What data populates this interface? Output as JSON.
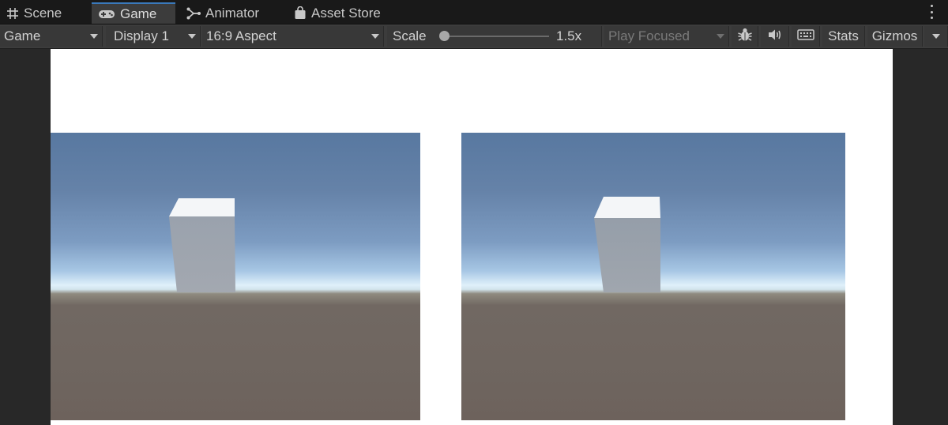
{
  "tabs": [
    {
      "label": "Scene",
      "icon": "grid-icon"
    },
    {
      "label": "Game",
      "icon": "gamepad-icon"
    },
    {
      "label": "Animator",
      "icon": "animator-icon"
    },
    {
      "label": "Asset Store",
      "icon": "shopping-bag-icon"
    }
  ],
  "toolbar": {
    "view_select": "Game",
    "display_select": "Display 1",
    "aspect_select": "16:9 Aspect",
    "scale_label": "Scale",
    "scale_value": "1.5x",
    "play_mode_select": "Play Focused",
    "stats_label": "Stats",
    "gizmos_label": "Gizmos",
    "icons": [
      "bug-icon",
      "audio-icon",
      "keyboard-icon"
    ]
  },
  "colors": {
    "accent": "#3a79bb",
    "panel": "#3c3c3c",
    "tabbar": "#191919",
    "sky_top": "#5878a0",
    "horizon": "#dff0fa",
    "ground": "#6f6660"
  }
}
